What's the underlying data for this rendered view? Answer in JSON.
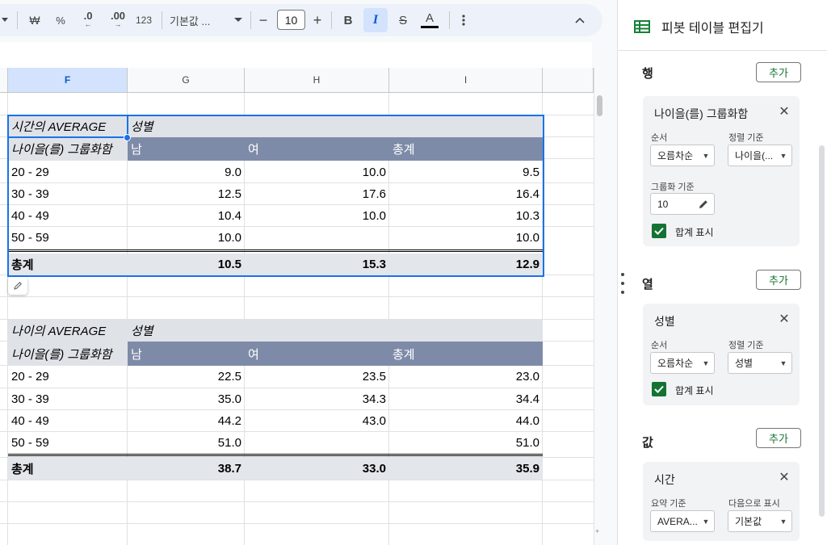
{
  "toolbar": {
    "currency": "₩",
    "percent": "%",
    "dec_decrease": ".0",
    "dec_increase": ".00",
    "number_format": "123",
    "format_label": "기본값 ...",
    "minus": "−",
    "font_size": "10",
    "plus": "+",
    "bold": "B",
    "italic": "I",
    "strike": "S",
    "text_color": "A"
  },
  "columns": [
    "F",
    "G",
    "H",
    "I"
  ],
  "pivot1": {
    "value_label": "시간의 AVERAGE",
    "col_field": "성별",
    "row_field": "나이을(를) 그룹화함",
    "headers": [
      "남",
      "여",
      "총계"
    ],
    "rows": [
      {
        "label": "20 - 29",
        "values": [
          "9.0",
          "10.0",
          "9.5"
        ]
      },
      {
        "label": "30 - 39",
        "values": [
          "12.5",
          "17.6",
          "16.4"
        ]
      },
      {
        "label": "40 - 49",
        "values": [
          "10.4",
          "10.0",
          "10.3"
        ]
      },
      {
        "label": "50 - 59",
        "values": [
          "10.0",
          "",
          "10.0"
        ]
      }
    ],
    "total": {
      "label": "총계",
      "values": [
        "10.5",
        "15.3",
        "12.9"
      ]
    }
  },
  "pivot2": {
    "value_label": "나이의 AVERAGE",
    "col_field": "성별",
    "row_field": "나이을(를) 그룹화함",
    "headers": [
      "남",
      "여",
      "총계"
    ],
    "rows": [
      {
        "label": "20 - 29",
        "values": [
          "22.5",
          "23.5",
          "23.0"
        ]
      },
      {
        "label": "30 - 39",
        "values": [
          "35.0",
          "34.3",
          "34.4"
        ]
      },
      {
        "label": "40 - 49",
        "values": [
          "44.2",
          "43.0",
          "44.0"
        ]
      },
      {
        "label": "50 - 59",
        "values": [
          "51.0",
          "",
          "51.0"
        ]
      }
    ],
    "total": {
      "label": "총계",
      "values": [
        "38.7",
        "33.0",
        "35.9"
      ]
    }
  },
  "panel": {
    "title": "피봇 테이블 편집기",
    "add_label": "추가",
    "rows_section": {
      "label": "행",
      "card_title": "나이을(를) 그룹화함",
      "order_label": "순서",
      "order_value": "오름차순",
      "sort_label": "정렬 기준",
      "sort_value": "나이을(...",
      "group_label": "그룹화 기준",
      "group_value": "10",
      "show_totals": "합계 표시"
    },
    "cols_section": {
      "label": "열",
      "card_title": "성별",
      "order_label": "순서",
      "order_value": "오름차순",
      "sort_label": "정렬 기준",
      "sort_value": "성별",
      "show_totals": "합계 표시"
    },
    "values_section": {
      "label": "값",
      "card_title": "시간",
      "summarize_label": "요약 기준",
      "summarize_value": "AVERA...",
      "show_as_label": "다음으로 표시",
      "show_as_value": "기본값"
    }
  },
  "colors": {
    "accent_blue": "#1a73e8",
    "pivot_header_dark": "#7e8ba8",
    "pivot_header_light": "#dfe3e8",
    "checkbox_green": "#137333"
  }
}
